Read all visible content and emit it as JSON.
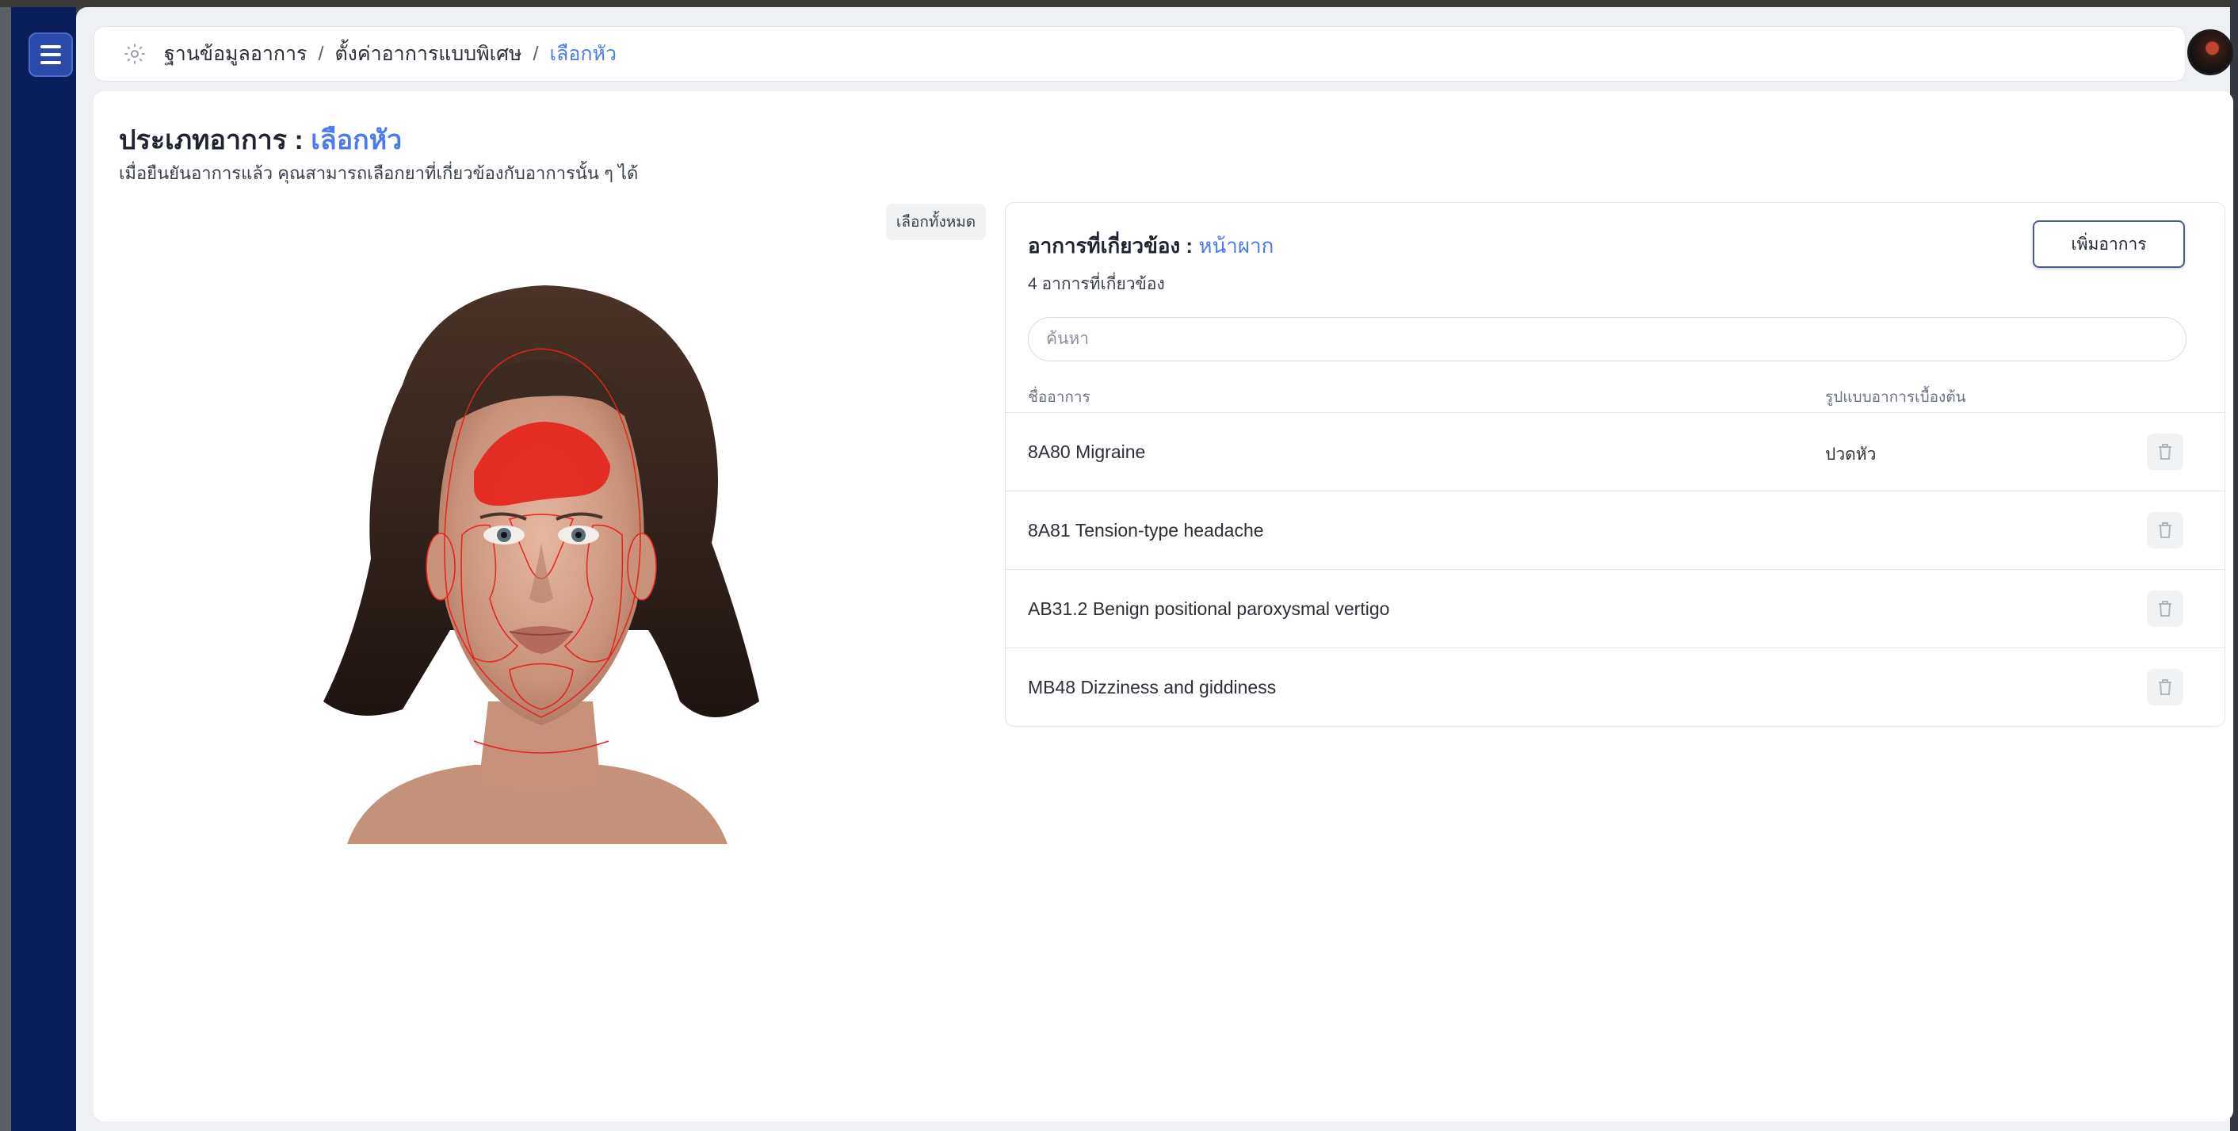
{
  "breadcrumb": {
    "items": [
      "ฐานข้อมูลอาการ",
      "ตั้งค่าอาการแบบพิเศษ",
      "เลือกหัว"
    ],
    "separator": "/"
  },
  "page": {
    "title_prefix": "ประเภทอาการ :",
    "title_value": "เลือกหัว",
    "subtitle": "เมื่อยืนยันอาการแล้ว คุณสามารถเลือกยาที่เกี่ยวข้องกับอาการนั้น ๆ ได้"
  },
  "face_selector": {
    "select_all_label": "เลือกทั้งหมด",
    "selected_region": "forehead",
    "highlight_color": "#e5231b"
  },
  "symptoms_panel": {
    "title_prefix": "อาการที่เกี่ยวข้อง :",
    "title_value": "หน้าผาก",
    "count_text": "4 อาการที่เกี่ยวข้อง",
    "add_button": "เพิ่มอาการ",
    "search_placeholder": "ค้นหา",
    "columns": [
      "ชื่ออาการ",
      "รูปแบบอาการเบื้องต้น"
    ],
    "rows": [
      {
        "name": "8A80 Migraine",
        "pattern": "ปวดหัว"
      },
      {
        "name": "8A81 Tension-type headache",
        "pattern": ""
      },
      {
        "name": "AB31.2 Benign positional paroxysmal vertigo",
        "pattern": ""
      },
      {
        "name": "MB48 Dizziness and giddiness",
        "pattern": ""
      }
    ]
  },
  "colors": {
    "sidebar": "#0a1e5c",
    "accent": "#4a7cf0",
    "highlight": "#e5231b"
  },
  "icons": {
    "menu": "hamburger-icon",
    "breadcrumb": "gear-icon",
    "delete": "trash-icon"
  }
}
